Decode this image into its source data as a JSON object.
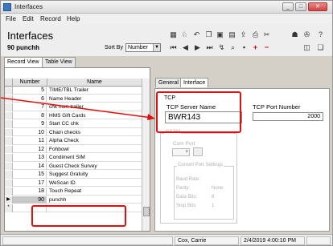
{
  "window": {
    "title": "Interfaces"
  },
  "menu": {
    "items": [
      "File",
      "Edit",
      "Record",
      "Help"
    ]
  },
  "header": {
    "module_title": "Interfaces",
    "record": "90 punchh",
    "sort_by_label": "Sort By",
    "sort_by_value": "Number"
  },
  "view_tabs": [
    "Record View",
    "Table View"
  ],
  "grid": {
    "columns": [
      "Number",
      "Name"
    ],
    "rows": [
      {
        "number": "5",
        "name": "TIME/TBL Trailer",
        "indicator": ""
      },
      {
        "number": "6",
        "name": "Name Header",
        "indicator": ""
      },
      {
        "number": "7",
        "name": "chk num trailer",
        "indicator": ""
      },
      {
        "number": "8",
        "name": "HMS Gift Cards",
        "indicator": ""
      },
      {
        "number": "9",
        "name": "Start CC chk",
        "indicator": ""
      },
      {
        "number": "10",
        "name": "Chain checks",
        "indicator": ""
      },
      {
        "number": "11",
        "name": "Alpha Check",
        "indicator": ""
      },
      {
        "number": "12",
        "name": "Fohbowl",
        "indicator": ""
      },
      {
        "number": "13",
        "name": "Condiment SIM",
        "indicator": ""
      },
      {
        "number": "14",
        "name": "Guest Check Survey",
        "indicator": ""
      },
      {
        "number": "15",
        "name": "Suggest Gratuity",
        "indicator": ""
      },
      {
        "number": "17",
        "name": "WeScan ID",
        "indicator": ""
      },
      {
        "number": "18",
        "name": "Touch Repeat",
        "indicator": ""
      },
      {
        "number": "90",
        "name": "punchh",
        "indicator": "▶"
      },
      {
        "number": "",
        "name": "",
        "indicator": "*"
      }
    ]
  },
  "detail_tabs": [
    "General",
    "Interface"
  ],
  "interface": {
    "tcp_label": "TCP",
    "tcp_server_label": "TCP Server Name",
    "tcp_server_value": "BWR143",
    "tcp_port_label": "TCP Port Number",
    "tcp_port_value": "2000",
    "rs232_label": "RS232",
    "com_port_label": "Com Port",
    "current_port_settings_label": "Current Port Settings",
    "settings": [
      {
        "label": "Baud Rate:",
        "value": ""
      },
      {
        "label": "Parity:",
        "value": "None"
      },
      {
        "label": "Data Bits:",
        "value": "8"
      },
      {
        "label": "Stop Bits:",
        "value": "1"
      }
    ]
  },
  "status": {
    "user": "Cox, Carrie",
    "datetime": "2/4/2019 4:00:10 PM"
  },
  "colors": {
    "annotation_red": "#e01010",
    "chrome": "#d4d0c8"
  }
}
